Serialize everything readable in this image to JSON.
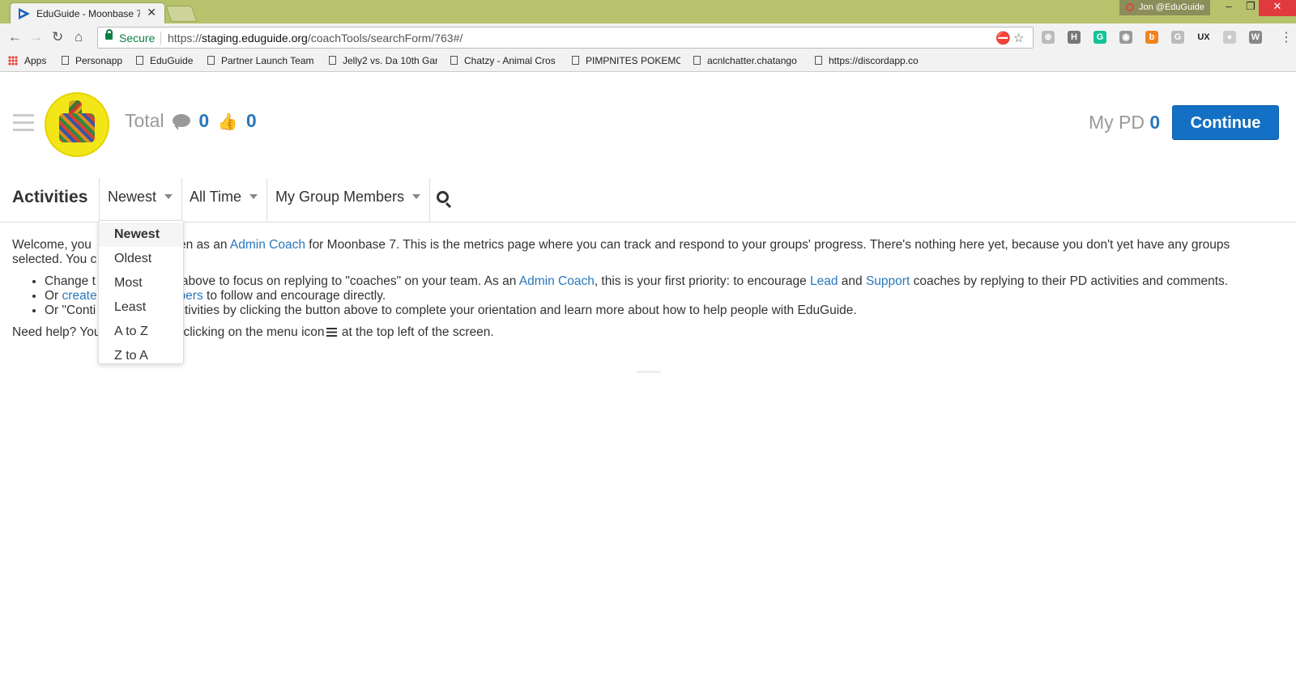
{
  "browser": {
    "tab_title": "EduGuide - Moonbase 7",
    "tab_close": "✕",
    "profile": "Jon @EduGuide",
    "window_buttons": {
      "minimize": "–",
      "maximize": "❐",
      "close": "✕"
    },
    "secure_label": "Secure",
    "url_scheme": "https://",
    "url_host": "staging.eduguide.org",
    "url_path": "/coachTools/searchForm/763#/",
    "bookmarks": [
      "Apps",
      "Personapp",
      "EduGuide",
      "Partner Launch Team",
      "Jelly2 vs. Da 10th Gar",
      "Chatzy - Animal Cros",
      "PIMPNITES POKEMO",
      "acnlchatter.chatango",
      "https://discordapp.co"
    ],
    "extensions": [
      "⊕",
      "H",
      "G",
      "◉",
      "b",
      "G",
      "UX",
      "●",
      "W"
    ]
  },
  "header": {
    "total_label": "Total",
    "comments_count": "0",
    "likes_count": "0",
    "mypd_label": "My PD",
    "mypd_count": "0",
    "continue_label": "Continue"
  },
  "filters": {
    "title": "Activities",
    "sort": "Newest",
    "time": "All Time",
    "group": "My Group Members"
  },
  "dropdown": {
    "options": [
      "Newest",
      "Oldest",
      "Most",
      "Least",
      "A to Z",
      "Z to A"
    ],
    "selected": "Newest"
  },
  "content": {
    "p1_a": "Welcome, you ",
    "p1_b": "sen as an ",
    "p1_link": "Admin Coach",
    "p1_c": " for Moonbase 7. This is the metrics page where you can track and respond to your groups' progress. There's nothing here yet, because you don't yet have any groups selected. You c",
    "li1_a": "Change t",
    "li1_b": "above to focus on replying to \"coaches\" on your team. As an ",
    "li1_link1": "Admin Coach",
    "li1_c": ", this is your first priority: to encourage ",
    "li1_link2": "Lead",
    "li1_d": " and ",
    "li1_link3": "Support",
    "li1_e": " coaches by replying to their PD activities and comments.",
    "li2_a": "Or ",
    "li2_link1": "create",
    "li2_link2": "mbers",
    "li2_b": " to follow and encourage directly.",
    "li3_a": "Or \"Conti",
    "li3_b": "ctivities by clicking the button above to complete your orientation and learn more about how to help people with EduGuide.",
    "help_a": "Need help? You",
    "help_b": "clicking on the menu icon",
    "help_c": " at the top left of the screen."
  }
}
